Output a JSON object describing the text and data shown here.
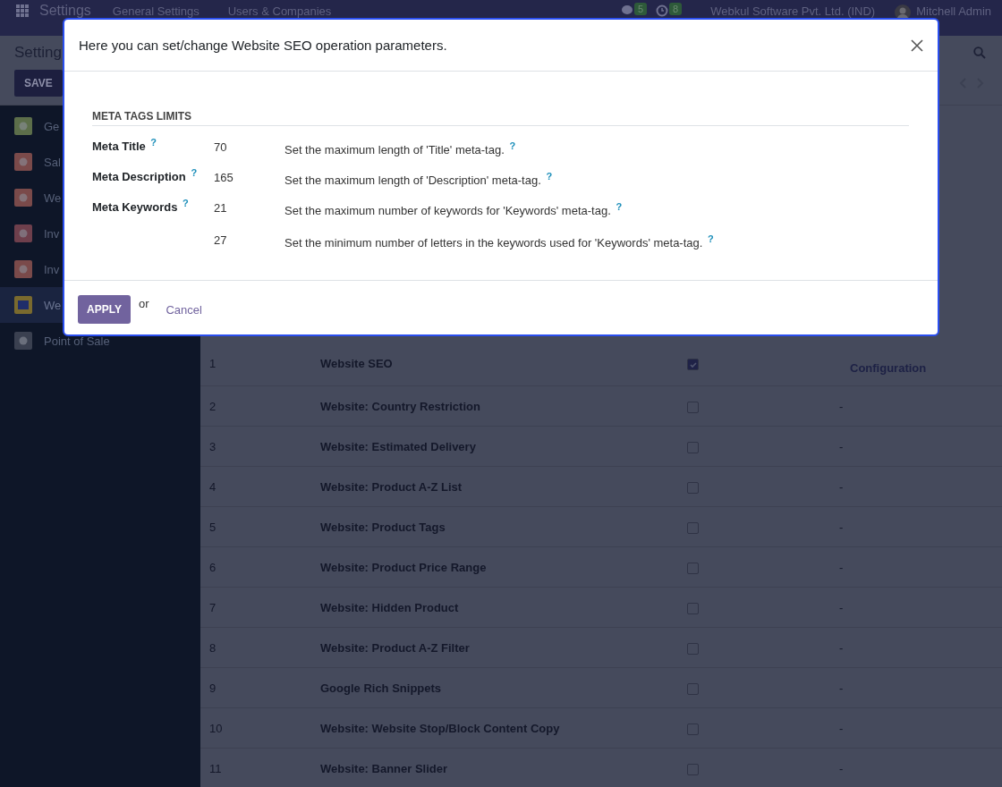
{
  "topbar": {
    "app_title": "Settings",
    "menu": [
      {
        "label": "General Settings"
      },
      {
        "label": "Users & Companies"
      }
    ],
    "messages_count": "5",
    "activities_count": "8",
    "company": "Webkul Software Pvt. Ltd. (IND)",
    "user": "Mitchell Admin"
  },
  "control_panel": {
    "title": "Setting",
    "save_button": "SAVE"
  },
  "sidebar": {
    "items": [
      {
        "label": "Ge",
        "selected": false,
        "color": "#5c6e4a"
      },
      {
        "label": "Sal",
        "selected": false,
        "color": "#7a4a4a"
      },
      {
        "label": "We",
        "selected": false,
        "color": "#7a4a4a"
      },
      {
        "label": "Inv",
        "selected": false,
        "color": "#6e3f4c"
      },
      {
        "label": "Inv",
        "selected": false,
        "color": "#7a4a4a"
      },
      {
        "label": "We",
        "selected": true,
        "color": "#7a6a2e"
      },
      {
        "label": "Point of Sale",
        "selected": false,
        "color": "#3a4050"
      }
    ]
  },
  "table": {
    "rows": [
      {
        "number": "1",
        "name": "Website SEO",
        "checked": true,
        "config": {
          "label": "Configuration",
          "kind": "link"
        }
      },
      {
        "number": "2",
        "name": "Website: Country Restriction",
        "checked": false,
        "config": {
          "label": "-",
          "kind": "text"
        }
      },
      {
        "number": "3",
        "name": "Website: Estimated Delivery",
        "checked": false,
        "config": {
          "label": "-",
          "kind": "text"
        }
      },
      {
        "number": "4",
        "name": "Website: Product A-Z List",
        "checked": false,
        "config": {
          "label": "-",
          "kind": "text"
        }
      },
      {
        "number": "5",
        "name": "Website: Product Tags",
        "checked": false,
        "config": {
          "label": "-",
          "kind": "text"
        }
      },
      {
        "number": "6",
        "name": "Website: Product Price Range",
        "checked": false,
        "config": {
          "label": "-",
          "kind": "text"
        }
      },
      {
        "number": "7",
        "name": "Website: Hidden Product",
        "checked": false,
        "config": {
          "label": "-",
          "kind": "text"
        }
      },
      {
        "number": "8",
        "name": "Website: Product A-Z Filter",
        "checked": false,
        "config": {
          "label": "-",
          "kind": "text"
        }
      },
      {
        "number": "9",
        "name": "Google Rich Snippets",
        "checked": false,
        "config": {
          "label": "-",
          "kind": "text"
        }
      },
      {
        "number": "10",
        "name": "Website: Website Stop/Block Content Copy",
        "checked": false,
        "config": {
          "label": "-",
          "kind": "text"
        }
      },
      {
        "number": "11",
        "name": "Website: Banner Slider",
        "checked": false,
        "config": {
          "label": "-",
          "kind": "text"
        }
      }
    ]
  },
  "dialog": {
    "title": "Here you can set/change Website SEO operation parameters.",
    "section": "META TAGS LIMITS",
    "fields": [
      {
        "label": "Meta Title",
        "label_tip": "?",
        "value": "70",
        "help": "Set the maximum length of 'Title' meta-tag.",
        "help_tip": "?"
      },
      {
        "label": "Meta Description",
        "label_tip": "?",
        "value": "165",
        "help": "Set the maximum length of 'Description' meta-tag.",
        "help_tip": "?"
      },
      {
        "label": "Meta Keywords",
        "label_tip": "?",
        "value": "21",
        "help": "Set the maximum number of keywords for 'Keywords' meta-tag.",
        "help_tip": "?"
      },
      {
        "value": "27",
        "help": "Set the minimum number of letters in the keywords used for 'Keywords' meta-tag.",
        "help_tip": "?"
      }
    ],
    "apply_button": "APPLY",
    "or_text": "or",
    "cancel_link": "Cancel"
  }
}
